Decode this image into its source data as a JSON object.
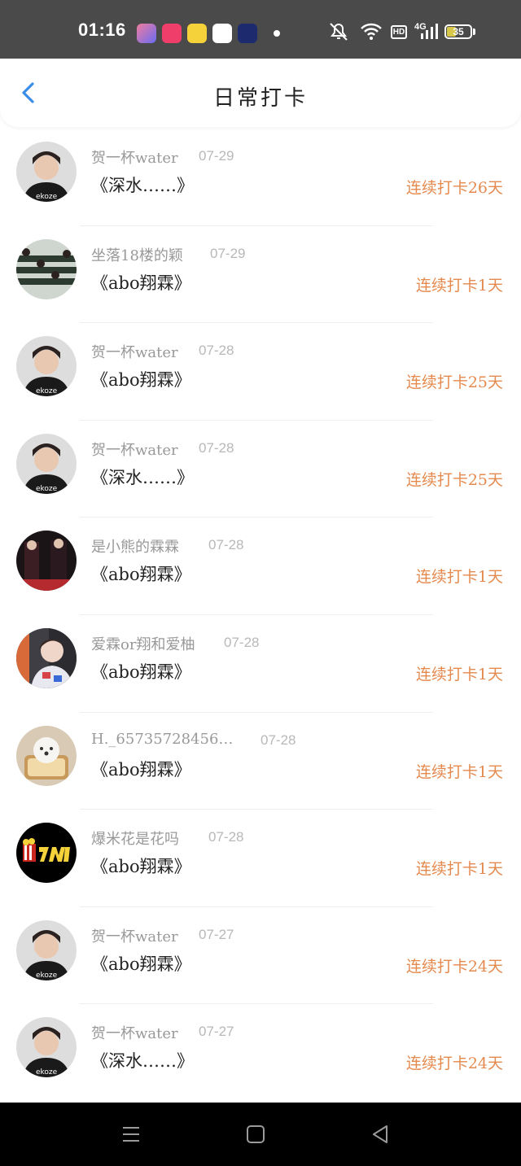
{
  "status_bar": {
    "time": "01:16",
    "network": "4G",
    "hd_label": "HD",
    "battery_level": "35",
    "app_icons": [
      {
        "name": "app-icon-1",
        "color": "#7b6cf0"
      },
      {
        "name": "app-icon-2",
        "color": "#ef3e6a"
      },
      {
        "name": "app-icon-3",
        "color": "#f5d23a"
      },
      {
        "name": "app-icon-4",
        "color": "#3f7bf2"
      },
      {
        "name": "app-icon-5",
        "color": "#1e2a6e"
      }
    ]
  },
  "header": {
    "title": "日常打卡",
    "back_icon": "chevron-left-icon"
  },
  "accent_color": "#e58a4e",
  "items": [
    {
      "user": "贺一杯water",
      "date": "07-29",
      "book": "《深水……》",
      "streak": "连续打卡26天"
    },
    {
      "user": "坐落18楼的颖",
      "date": "07-29",
      "book": "《abo翔霖》",
      "streak": "连续打卡1天"
    },
    {
      "user": "贺一杯water",
      "date": "07-28",
      "book": "《abo翔霖》",
      "streak": "连续打卡25天"
    },
    {
      "user": "贺一杯water",
      "date": "07-28",
      "book": "《深水……》",
      "streak": "连续打卡25天"
    },
    {
      "user": "是小熊的霖霖",
      "date": "07-28",
      "book": "《abo翔霖》",
      "streak": "连续打卡1天"
    },
    {
      "user": "爱霖or翔和爱柚",
      "date": "07-28",
      "book": "《abo翔霖》",
      "streak": "连续打卡1天"
    },
    {
      "user": "H._65735728456…",
      "date": "07-28",
      "book": "《abo翔霖》",
      "streak": "连续打卡1天"
    },
    {
      "user": "爆米花是花吗",
      "date": "07-28",
      "book": "《abo翔霖》",
      "streak": "连续打卡1天"
    },
    {
      "user": "贺一杯water",
      "date": "07-27",
      "book": "《abo翔霖》",
      "streak": "连续打卡24天"
    },
    {
      "user": "贺一杯water",
      "date": "07-27",
      "book": "《深水……》",
      "streak": "连续打卡24天"
    }
  ],
  "bottom_nav": [
    "menu-icon",
    "home-icon",
    "back-icon"
  ]
}
